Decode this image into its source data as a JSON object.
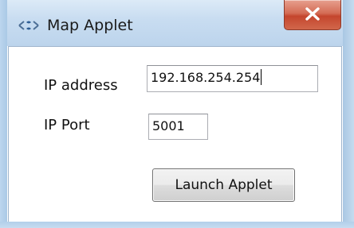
{
  "window": {
    "title": "Map Applet",
    "icon": "map-applet-icon",
    "close_icon": "close-icon",
    "accent": "#c4452d"
  },
  "form": {
    "ip_address_label": "IP address",
    "ip_address_value": "192.168.254.254",
    "ip_port_label": "IP Port",
    "ip_port_value": "5001"
  },
  "actions": {
    "launch_label": "Launch Applet"
  }
}
